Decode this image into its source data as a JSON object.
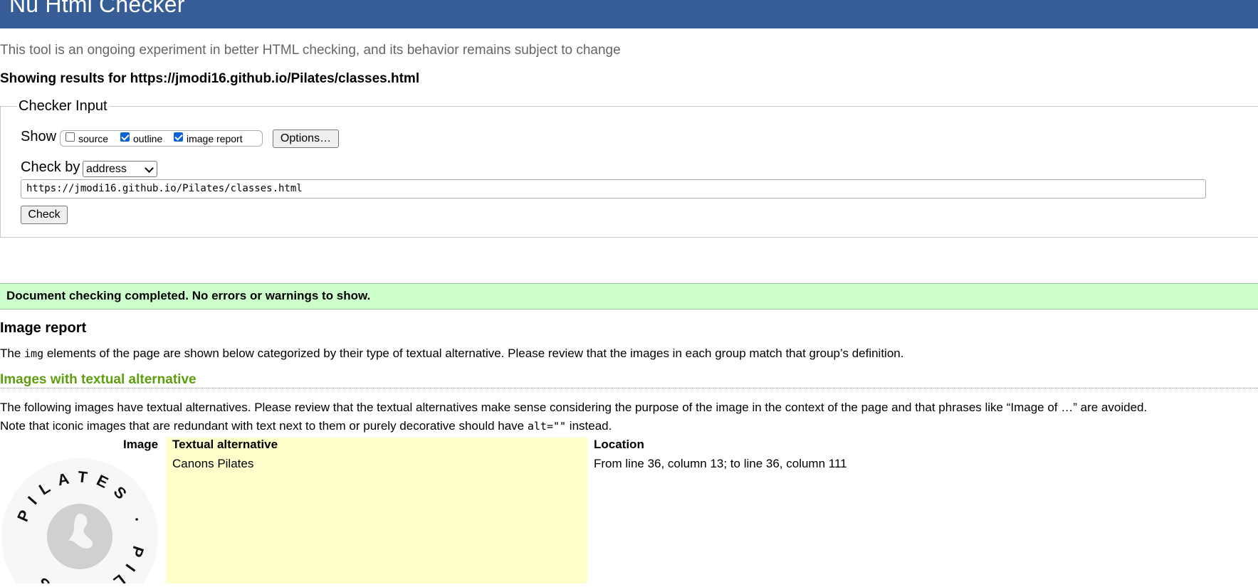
{
  "header": {
    "title": "Nu Html Checker"
  },
  "tagline": "This tool is an ongoing experiment in better HTML checking, and its behavior remains subject to change",
  "results_heading": "Showing results for https://jmodi16.github.io/Pilates/classes.html",
  "checker_input": {
    "legend": "Checker Input",
    "show_label": "Show",
    "checkboxes": [
      {
        "label": "source",
        "checked": false
      },
      {
        "label": "outline",
        "checked": true
      },
      {
        "label": "image report",
        "checked": true
      }
    ],
    "options_button": "Options…",
    "check_by_label": "Check by",
    "check_by_value": "address",
    "url_value": "https://jmodi16.github.io/Pilates/classes.html",
    "check_button": "Check"
  },
  "status_message": "Document checking completed. No errors or warnings to show.",
  "image_report": {
    "heading": "Image report",
    "intro_before": "The ",
    "intro_code": "img",
    "intro_after": " elements of the page are shown below categorized by their type of textual alternative. Please review that the images in each group match that group’s definition.",
    "group_heading": "Images with textual alternative",
    "group_desc_1": "The following images have textual alternatives. Please review that the textual alternatives make sense considering the purpose of the image in the context of the page and that phrases like “Image of …” are avoided.",
    "group_desc_2_before": "Note that iconic images that are redundant with text next to them or purely decorative should have ",
    "group_desc_2_code": "alt=\"\"",
    "group_desc_2_after": " instead.",
    "table": {
      "headers": {
        "image": "Image",
        "alt": "Textual alternative",
        "location": "Location"
      },
      "rows": [
        {
          "image_icon": "pilates-logo",
          "alt": "Canons Pilates",
          "location": "From line 36, column 13; to line 36, column 111"
        }
      ]
    }
  },
  "logo_text": "PILATES"
}
